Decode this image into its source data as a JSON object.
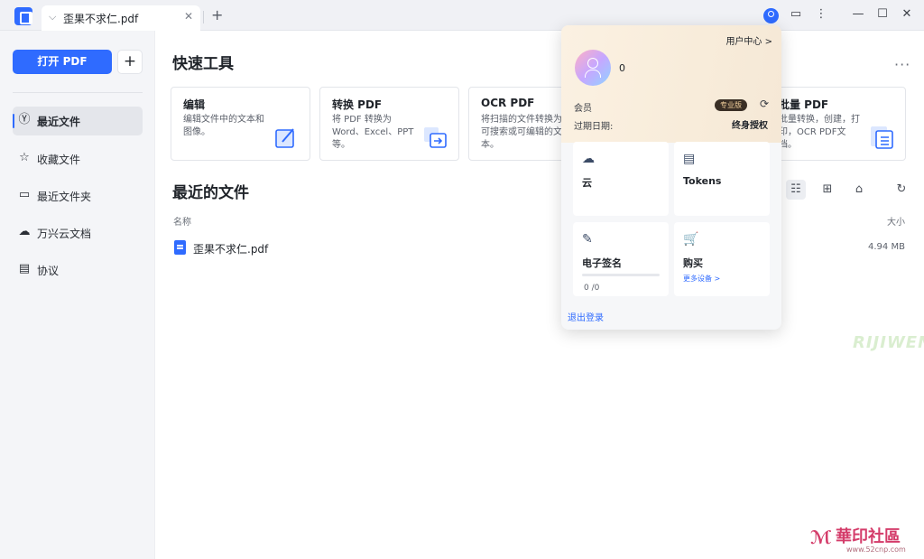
{
  "titlebar": {
    "tab_title": "歪果不求仁.pdf",
    "new_tab": "+",
    "tab_close": "✕"
  },
  "sidebar": {
    "open_button": "打开 PDF",
    "add_button": "+",
    "items": [
      {
        "label": "最近文件",
        "icon": "clock-icon",
        "active": true
      },
      {
        "label": "收藏文件",
        "icon": "star-icon",
        "active": false
      },
      {
        "label": "最近文件夹",
        "icon": "folder-icon",
        "active": false
      },
      {
        "label": "万兴云文档",
        "icon": "cloud-icon",
        "active": false
      },
      {
        "label": "协议",
        "icon": "document-icon",
        "active": false
      }
    ]
  },
  "main": {
    "quick_tools_title": "快速工具",
    "tools": [
      {
        "title": "编辑",
        "desc": "编辑文件中的文本和图像。",
        "icon": "edit-icon"
      },
      {
        "title": "转换 PDF",
        "desc": "将 PDF 转换为 Word、Excel、PPT等。",
        "icon": "convert-icon"
      },
      {
        "title": "OCR PDF",
        "desc": "将扫描的文件转换为可搜索或可编辑的文本。",
        "icon": "ocr-icon"
      },
      {
        "title": "批量 PDF",
        "desc": "批量转换，创建，打印，OCR PDF文档。",
        "icon": "batch-icon"
      }
    ],
    "recent_files_title": "最近的文件",
    "col_name": "名称",
    "col_size": "大小",
    "files": [
      {
        "name": "歪果不求仁.pdf",
        "size": "4.94 MB"
      }
    ]
  },
  "popup": {
    "user_center": "用户中心 >",
    "user_name": "0",
    "member_label": "会员",
    "pro_badge": "专业版",
    "expire_label": "过期日期:",
    "expire_value": "终身授权",
    "cards": [
      {
        "label": "云",
        "icon": "cloud-sync-icon"
      },
      {
        "label": "Tokens",
        "icon": "tokens-icon"
      },
      {
        "label": "电子签名",
        "icon": "pen-icon",
        "value": "0 /0"
      },
      {
        "label": "购买",
        "icon": "cart-icon",
        "link": "更多设备 >"
      }
    ],
    "logout": "退出登录"
  },
  "watermark": {
    "brand": "RIJIWEN",
    "site_cn": "華印社區",
    "site_url": "www.52cnp.com"
  },
  "colors": {
    "accent": "#2f6bff",
    "popup_bg": "#fbf1e2",
    "badge_bg": "#3a2f25",
    "badge_text": "#f1cf9b"
  }
}
